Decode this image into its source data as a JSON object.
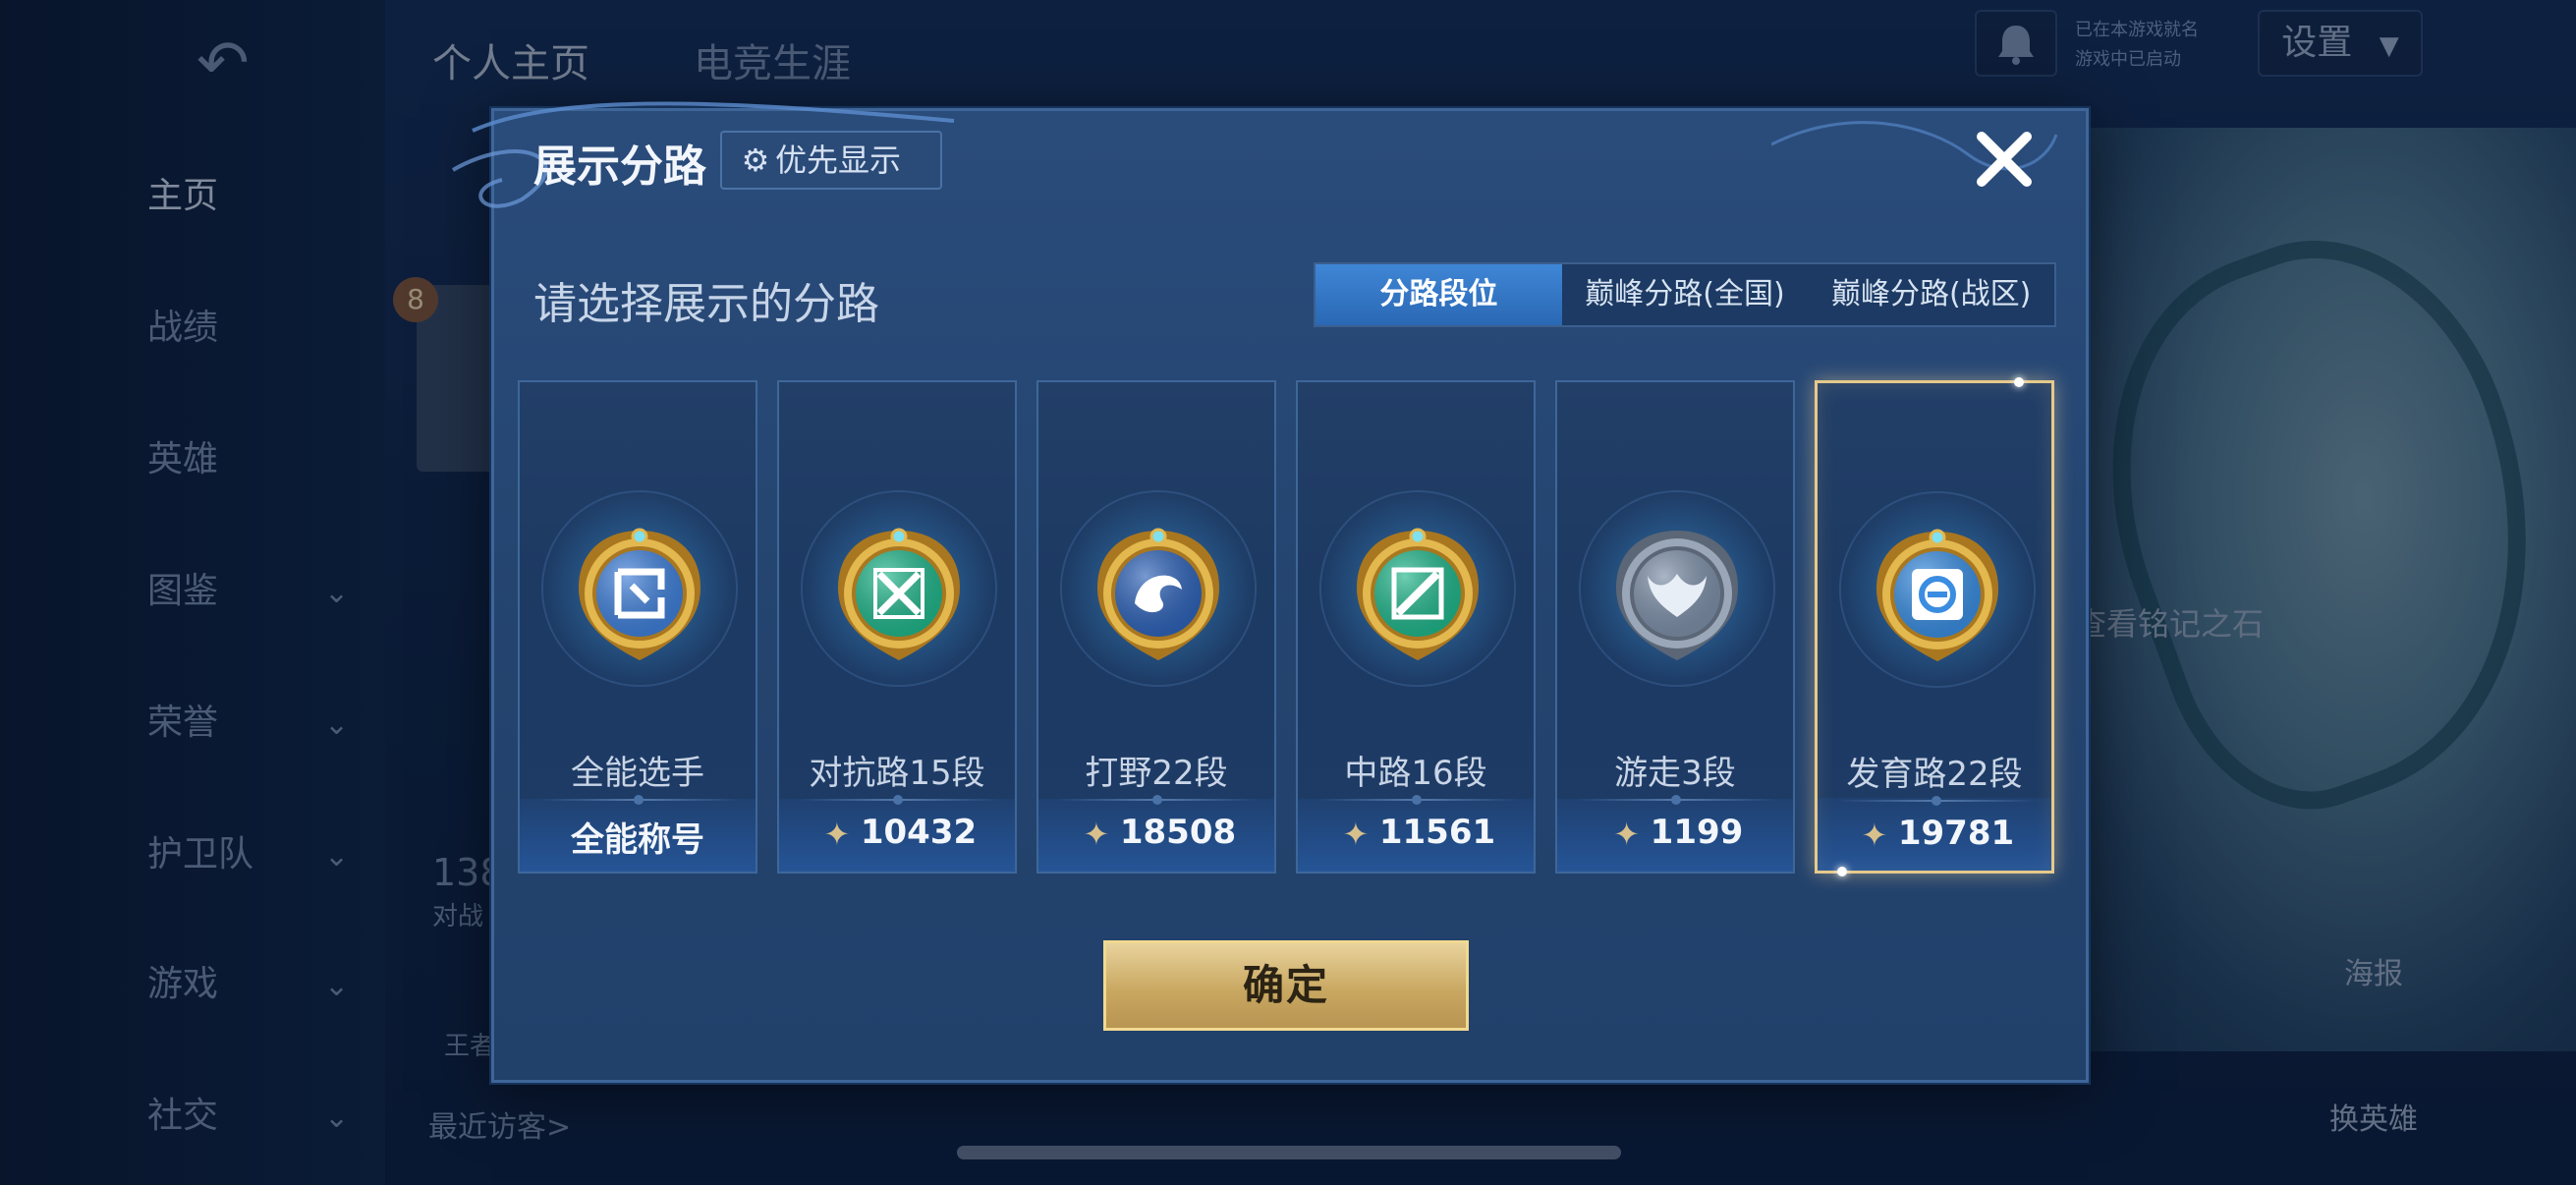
{
  "background": {
    "top_tabs": [
      "个人主页",
      "电竞生涯"
    ],
    "settings_label": "设置",
    "mini_status_1": "已在本游戏就名",
    "mini_status_2": "游戏中已启动",
    "sidebar": [
      {
        "label": "主页",
        "chevron": false,
        "active": true
      },
      {
        "label": "战绩",
        "chevron": false
      },
      {
        "label": "英雄",
        "chevron": false
      },
      {
        "label": "图鉴",
        "chevron": true
      },
      {
        "label": "荣誉",
        "chevron": true
      },
      {
        "label": "护卫队",
        "chevron": true
      },
      {
        "label": "游戏",
        "chevron": true
      },
      {
        "label": "社交",
        "chevron": true
      }
    ],
    "level_badge": "8",
    "battles_count": "138",
    "battles_label": "对战",
    "rank_label": "王者",
    "recent_visitors": "最近访客>",
    "inscription_hint": "查看铭记之石",
    "poster_label": "海报",
    "change_hero_label": "换英雄"
  },
  "modal": {
    "title": "展示分路",
    "priority_button": "优先显示",
    "subtitle": "请选择展示的分路",
    "tabs": [
      "分路段位",
      "巅峰分路(全国)",
      "巅峰分路(战区)"
    ],
    "active_tab": 0,
    "cards": [
      {
        "name": "全能选手",
        "score": "全能称号",
        "has_score_icon": false,
        "emblem": "all-round",
        "color": "#3f7fd8"
      },
      {
        "name": "对抗路15段",
        "score": "10432",
        "has_score_icon": true,
        "emblem": "clash-lane",
        "color": "#21b58a"
      },
      {
        "name": "打野22段",
        "score": "18508",
        "has_score_icon": true,
        "emblem": "jungle",
        "color": "#2f63b8"
      },
      {
        "name": "中路16段",
        "score": "11561",
        "has_score_icon": true,
        "emblem": "mid-lane",
        "color": "#21b58a"
      },
      {
        "name": "游走3段",
        "score": "1199",
        "has_score_icon": true,
        "emblem": "roam",
        "color": "#7d8fa8"
      },
      {
        "name": "发育路22段",
        "score": "19781",
        "has_score_icon": true,
        "emblem": "farm-lane",
        "color": "#3a8de0",
        "selected": true
      }
    ],
    "confirm_button": "确定"
  }
}
